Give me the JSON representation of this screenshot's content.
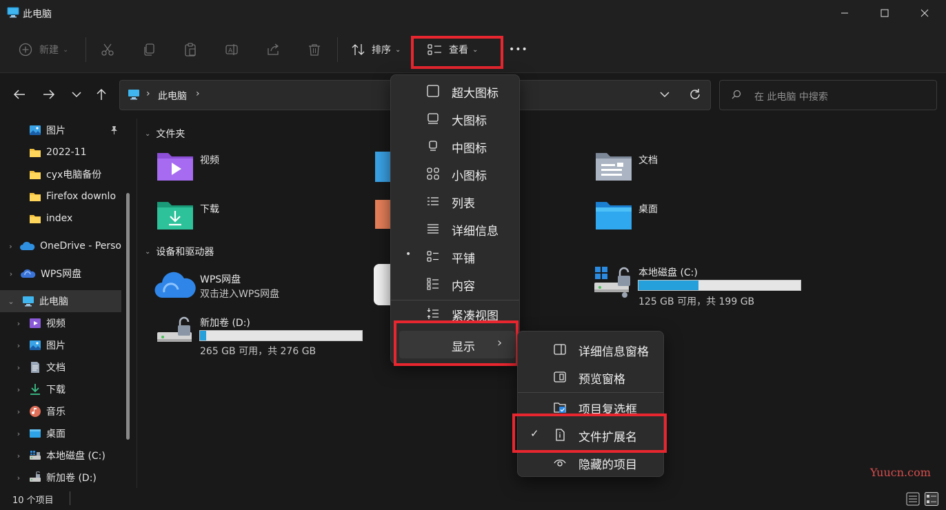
{
  "window": {
    "title": "此电脑"
  },
  "toolbar": {
    "new_label": "新建",
    "sort_label": "排序",
    "view_label": "查看",
    "more_label": "•••"
  },
  "address": {
    "separator": "›",
    "path": "此电脑",
    "search_placeholder": "在 此电脑 中搜索"
  },
  "sidebar": {
    "quick": [
      {
        "label": "图片",
        "icon": "pictures-icon",
        "pinned": true
      },
      {
        "label": "2022-11",
        "icon": "folder-icon"
      },
      {
        "label": "cyx电脑备份",
        "icon": "folder-icon"
      },
      {
        "label": "Firefox downlo",
        "icon": "folder-icon"
      },
      {
        "label": "index",
        "icon": "folder-icon"
      }
    ],
    "onedrive": "OneDrive - Perso",
    "wps": "WPS网盘",
    "thispc": "此电脑",
    "pc_children": [
      {
        "label": "视频",
        "icon": "videos-icon"
      },
      {
        "label": "图片",
        "icon": "pictures-icon"
      },
      {
        "label": "文档",
        "icon": "documents-icon"
      },
      {
        "label": "下载",
        "icon": "downloads-icon"
      },
      {
        "label": "音乐",
        "icon": "music-icon"
      },
      {
        "label": "桌面",
        "icon": "desktop-icon"
      },
      {
        "label": "本地磁盘 (C:)",
        "icon": "drive-c-icon"
      },
      {
        "label": "新加卷 (D:)",
        "icon": "drive-d-icon"
      }
    ]
  },
  "content": {
    "folders_title": "文件夹",
    "folders": {
      "videos": "视频",
      "downloads": "下载",
      "documents": "文档",
      "desktop": "桌面"
    },
    "devices_title": "设备和驱动器",
    "wps_drive": {
      "name": "WPS网盘",
      "sub": "双击进入WPS网盘"
    },
    "drive_c": {
      "name": "本地磁盘 (C:)",
      "sub": "125 GB 可用，共 199 GB",
      "used_fraction": 0.37
    },
    "drive_d": {
      "name": "新加卷 (D:)",
      "sub": "265 GB 可用，共 276 GB",
      "used_fraction": 0.04
    }
  },
  "status": {
    "count": "10 个项目"
  },
  "view_menu": {
    "items": [
      {
        "label": "超大图标",
        "icon": "extra-large-icons-icon"
      },
      {
        "label": "大图标",
        "icon": "large-icons-icon"
      },
      {
        "label": "中图标",
        "icon": "medium-icons-icon"
      },
      {
        "label": "小图标",
        "icon": "small-icons-icon"
      },
      {
        "label": "列表",
        "icon": "list-icon"
      },
      {
        "label": "详细信息",
        "icon": "details-icon"
      },
      {
        "label": "平铺",
        "icon": "tiles-icon",
        "selected": true
      },
      {
        "label": "内容",
        "icon": "content-icon"
      },
      {
        "label": "紧凑视图",
        "icon": "compact-view-icon"
      },
      {
        "label": "显示",
        "icon": "",
        "submenu": true
      }
    ],
    "bullet": "•",
    "arrow": "›"
  },
  "show_menu": {
    "items": [
      {
        "label": "详细信息窗格",
        "icon": "details-pane-icon"
      },
      {
        "label": "预览窗格",
        "icon": "preview-pane-icon"
      },
      {
        "label": "项目复选框",
        "icon": "item-checkbox-icon"
      },
      {
        "label": "文件扩展名",
        "icon": "file-extension-icon",
        "checked": true
      },
      {
        "label": "隐藏的项目",
        "icon": "hidden-items-icon"
      }
    ],
    "check": "✓"
  },
  "watermark": "Yuucn.com",
  "colors": {
    "accent": "#26a0da",
    "highlight_box": "#e8262f",
    "folder_yellow": "#f5c342"
  }
}
